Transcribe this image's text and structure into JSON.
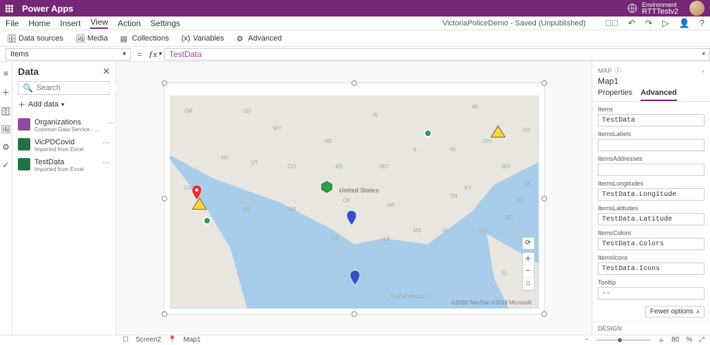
{
  "titlebar": {
    "brand": "Power Apps",
    "env_label": "Environment",
    "env_name": "RTTTestv2"
  },
  "menu": {
    "file": "File",
    "home": "Home",
    "insert": "Insert",
    "view": "View",
    "action": "Action",
    "settings": "Settings",
    "doc_title": "VictoriaPoliceDemo - Saved (Unpublished)"
  },
  "ribbon": {
    "data_sources": "Data sources",
    "media": "Media",
    "collections": "Collections",
    "variables": "Variables",
    "advanced": "Advanced"
  },
  "formula": {
    "property": "Items",
    "value": "TestData"
  },
  "data_panel": {
    "title": "Data",
    "search_placeholder": "Search",
    "add_label": "Add data",
    "sources": [
      {
        "name": "Organizations",
        "sub": "Common Data Service - Current enviro…",
        "icon": "purple"
      },
      {
        "name": "VicPDCovid",
        "sub": "Imported from Excel",
        "icon": "green"
      },
      {
        "name": "TestData",
        "sub": "Imported from Excel",
        "icon": "green"
      }
    ]
  },
  "map": {
    "center_label": "United States",
    "states": [
      "OR",
      "WY",
      "NE",
      "SD",
      "IA",
      "MI",
      "NV",
      "UT",
      "CO",
      "KS",
      "MO",
      "IL",
      "IN",
      "OH",
      "PA",
      "WV",
      "VA",
      "CA",
      "AZ",
      "NM",
      "OK",
      "AR",
      "TN",
      "NC",
      "SC",
      "TX",
      "LA",
      "MS",
      "AL",
      "GA",
      "FL",
      "KY"
    ],
    "gulf": "Gulf of Mexico",
    "attribution": "©2020 TomTom ©2019 Microsoft"
  },
  "props": {
    "crumb": "MAP",
    "name": "Map1",
    "tabs": {
      "properties": "Properties",
      "advanced": "Advanced"
    },
    "fields": {
      "Items": "TestData",
      "ItemsLabels": "",
      "ItemsAddresses": "",
      "ItemsLongitudes": "TestData.Longitude",
      "ItemsLatitudes": "TestData.Latitude",
      "ItemsColors": "TestData.Colors",
      "ItemsIcons": "TestData.Icons",
      "Tooltip": "--"
    },
    "field_labels": {
      "Items": "Items",
      "ItemsLabels": "ItemsLabels",
      "ItemsAddresses": "ItemsAddresses",
      "ItemsLongitudes": "ItemsLongitudes",
      "ItemsLatitudes": "ItemsLatitudes",
      "ItemsColors": "ItemsColors",
      "ItemsIcons": "ItemsIcons",
      "Tooltip": "Tooltip"
    },
    "fewer": "Fewer options",
    "design": "DESIGN"
  },
  "status": {
    "screen": "Screen2",
    "sel": "Map1",
    "zoom": "80",
    "pct": "%"
  }
}
